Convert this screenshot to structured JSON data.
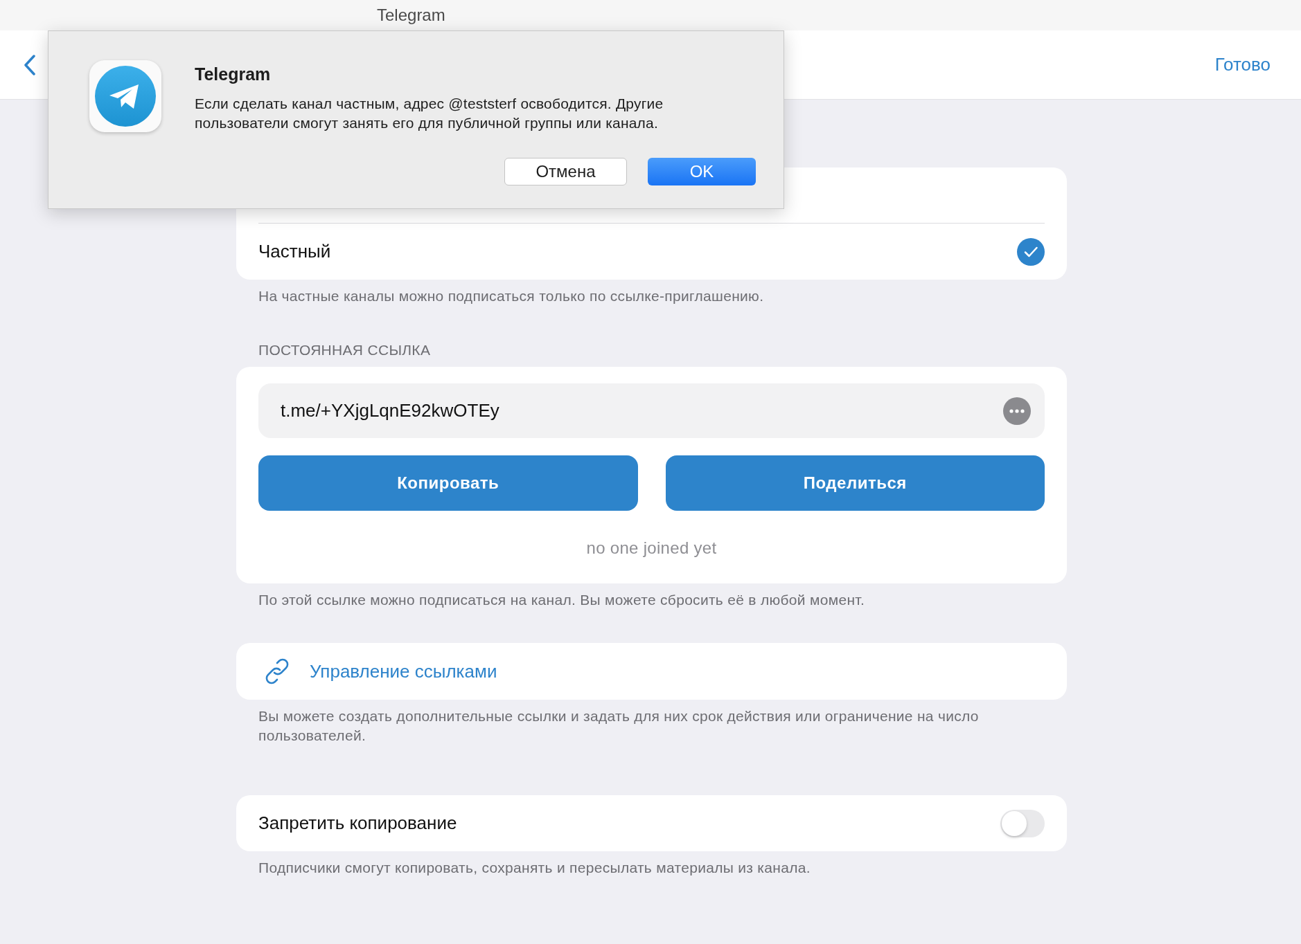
{
  "window": {
    "title": "Telegram"
  },
  "header": {
    "done_button": "Готово"
  },
  "channel_type": {
    "options": [
      {
        "label": "Частный",
        "selected": true
      }
    ],
    "footer": "На частные каналы можно подписаться только по ссылке-приглашению."
  },
  "invite_link": {
    "header": "ПОСТОЯННАЯ ССЫЛКА",
    "link": "t.me/+YXjgLqnE92kwOTEy",
    "buttons": [
      "Копировать",
      "Поделиться"
    ],
    "joined": "no one joined yet",
    "footer": "По этой ссылке можно подписаться на канал. Вы можете сбросить её в любой момент."
  },
  "manage_links": {
    "label": "Управление ссылками",
    "footer": "Вы можете создать дополнительные ссылки и задать для них срок действия или ограничение на число пользователей."
  },
  "restrict_copy": {
    "label": "Запретить копирование",
    "on": false,
    "footer": "Подписчики смогут копировать, сохранять и пересылать материалы из канала."
  },
  "dialog": {
    "title": "Telegram",
    "message": "Если сделать канал частным, адрес @teststerf освободится. Другие пользователи смогут занять его для публичной группы или канала.",
    "buttons": [
      {
        "label": "Отмена",
        "kind": "secondary"
      },
      {
        "label": "OK",
        "kind": "primary"
      }
    ]
  }
}
